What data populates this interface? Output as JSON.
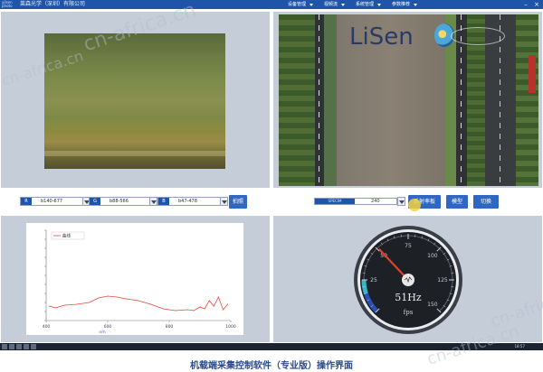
{
  "titlebar": {
    "logo": "yilsen\nphoto",
    "company": "莱森光学（深圳）有限公司",
    "menu": [
      "设备管理",
      "视频流",
      "系统管理",
      "参数推荐"
    ],
    "window_buttons": [
      "–",
      "×"
    ]
  },
  "top_right": {
    "brand": "LiSen"
  },
  "controls_left": {
    "selects": [
      {
        "tag": "R",
        "value": "b140-677"
      },
      {
        "tag": "G",
        "value": "b88-566"
      },
      {
        "tag": "B",
        "value": "b47-478"
      }
    ],
    "capture_button": "拍照"
  },
  "controls_right": {
    "select_left": "SPECIM",
    "select_value": "240",
    "buttons": [
      "反射率板",
      "模型",
      "切换"
    ]
  },
  "spectrum_chart": {
    "legend": "曲线"
  },
  "gauge": {
    "value_text": "51Hz",
    "unit": "fps",
    "ticks": [
      "25",
      "50",
      "75",
      "100",
      "125",
      "150"
    ],
    "value": 51
  },
  "taskbar": {
    "clock": "18:57"
  },
  "caption": "机载端采集控制软件（专业版）操作界面",
  "watermark": "cn-africa.cn",
  "chart_data": {
    "type": "line",
    "title": "",
    "xlabel": "nm",
    "ylabel": "",
    "legend": [
      "曲线"
    ],
    "xlim": [
      400,
      1000
    ],
    "ylim": [
      0,
      1
    ],
    "x": [
      410,
      430,
      460,
      500,
      540,
      570,
      600,
      630,
      660,
      700,
      740,
      780,
      820,
      860,
      880,
      900,
      915,
      930,
      945,
      960,
      975,
      990
    ],
    "series": [
      {
        "name": "曲线",
        "values": [
          0.16,
          0.14,
          0.17,
          0.18,
          0.2,
          0.25,
          0.27,
          0.26,
          0.24,
          0.22,
          0.18,
          0.13,
          0.11,
          0.12,
          0.11,
          0.15,
          0.13,
          0.22,
          0.16,
          0.26,
          0.12,
          0.18
        ]
      }
    ],
    "xticks": [
      "400",
      "600",
      "800",
      "1000"
    ],
    "colors": {
      "line": "#e24a3a"
    }
  },
  "colors": {
    "accent": "#1f55a8",
    "button": "#2f67c2",
    "pane": "#c5cdd9"
  }
}
